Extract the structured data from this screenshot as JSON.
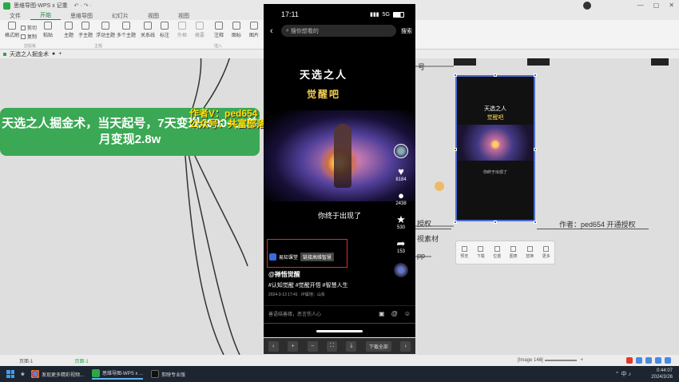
{
  "app": {
    "title": "思维导图-WPS x 记重",
    "login": "",
    "window_controls": [
      "—",
      "▢",
      "✕"
    ]
  },
  "menu": {
    "tabs": [
      "文件",
      "开始",
      "思维导图",
      "幻灯片",
      "视图",
      "视图"
    ]
  },
  "toolbar": {
    "items": [
      {
        "label": "格式刷"
      },
      {
        "label": "剪切"
      },
      {
        "label": "复制"
      },
      {
        "label": "粘贴"
      },
      {
        "label": "子主题"
      },
      {
        "label": "主题"
      },
      {
        "label": "浮动主题"
      },
      {
        "label": "多个主题"
      },
      {
        "label": "关系线"
      },
      {
        "label": "标注"
      },
      {
        "label": "外框"
      },
      {
        "label": "概要"
      },
      {
        "label": "注释"
      },
      {
        "label": "图标"
      },
      {
        "label": "图片"
      }
    ],
    "groups": [
      "剪贴板",
      "主题",
      "插入"
    ]
  },
  "doctab": {
    "name": "天选之人掘金术"
  },
  "canvas": {
    "center_node": "天选之人掘金术，当天起号，7天变现4000+，单月变现2.8w",
    "overlay_line1": "作者V：ped654",
    "overlay_line2": "公众号：共富部落",
    "right_nodes": {
      "node_a": "号",
      "node_b": "授权",
      "node_c": "视素材",
      "node_d": "pp",
      "author_node": "作者：ped654 开通授权"
    },
    "thumb": {
      "title1": "天选之人",
      "title2": "觉醒吧",
      "caption": "你终于出现了"
    },
    "mini_toolbar": [
      "预览",
      "下载",
      "位置",
      "图表",
      "替换",
      "更多"
    ]
  },
  "phone": {
    "time": "17:11",
    "signal": "5G",
    "search_placeholder": "搜你想看的",
    "search_button": "搜索",
    "video_title": "天选之人",
    "video_subtitle": "觉醒吧",
    "caption": "你终于出现了",
    "side": {
      "likes": "8184",
      "comments": "2438",
      "favorites": "530",
      "shares": "153"
    },
    "ad_label": "易知课堂",
    "ad_cta": "链接高维智慧",
    "username": "@禅悟觉醒",
    "tags": "#认知觉醒 #觉醒开悟 #智慧人生",
    "meta": "2024-3-13 17:41 · IP属地：山东",
    "comment_placeholder": "善语结善缘，恶言伤人心"
  },
  "viewer": {
    "download_all": "下载全部"
  },
  "statusbar": {
    "page1": "页面-1",
    "page2": "页面-1",
    "image_count": "[Image 148]"
  },
  "taskbar": {
    "task1": "发现更多精彩视频...",
    "task2": "思维导图-WPS x ...",
    "task3": "剪映专业版",
    "time": "0:44:07",
    "date": "2024/3/26"
  }
}
